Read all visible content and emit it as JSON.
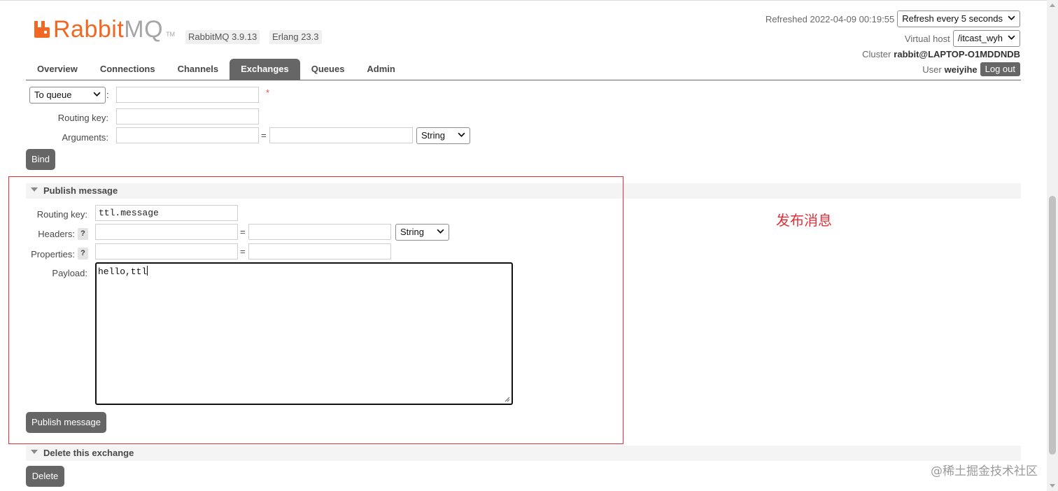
{
  "header": {
    "logo": {
      "brand": "Rabbit",
      "brand_suffix": "MQ",
      "tm": "TM"
    },
    "version_badge": "RabbitMQ 3.9.13",
    "erlang_badge": "Erlang 23.3",
    "refreshed_label": "Refreshed 2022-04-09 00:19:55",
    "refresh_select": "Refresh every 5 seconds",
    "vhost_label": "Virtual host",
    "vhost_select": "/itcast_wyh",
    "cluster_label": "Cluster",
    "cluster_value": "rabbit@LAPTOP-O1MDDNDB",
    "user_label": "User",
    "user_value": "weiyihe",
    "logout": "Log out"
  },
  "nav": {
    "tabs": [
      {
        "label": "Overview"
      },
      {
        "label": "Connections"
      },
      {
        "label": "Channels"
      },
      {
        "label": "Exchanges",
        "active": true
      },
      {
        "label": "Queues"
      },
      {
        "label": "Admin"
      }
    ]
  },
  "bind": {
    "destination_select": "To queue",
    "colon": ":",
    "required_mark": "*",
    "routing_key_label": "Routing key:",
    "arguments_label": "Arguments:",
    "equals": "=",
    "type_select": "String",
    "bind_button": "Bind"
  },
  "publish": {
    "title": "Publish message",
    "routing_key_label": "Routing key:",
    "routing_key_value": "ttl.message",
    "headers_label": "Headers:",
    "properties_label": "Properties:",
    "help": "?",
    "equals": "=",
    "type_select": "String",
    "payload_label": "Payload:",
    "payload_value": "hello,ttl",
    "publish_button": "Publish message"
  },
  "delete_section": {
    "title": "Delete this exchange",
    "delete_button": "Delete"
  },
  "annotation": "发布消息",
  "watermark": "@稀土掘金技术社区",
  "colors": {
    "accent": "#f26822",
    "tab_active": "#666666",
    "highlight": "#e0313a"
  }
}
